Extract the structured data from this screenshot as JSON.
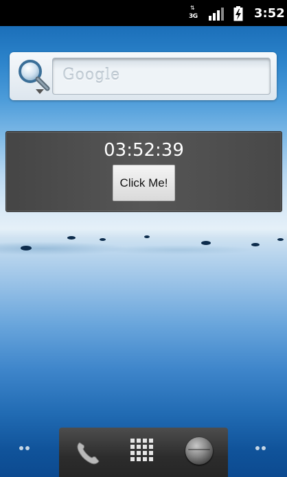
{
  "status_bar": {
    "network_type": "3G",
    "time": "3:52"
  },
  "search_widget": {
    "placeholder": "Google"
  },
  "clock_widget": {
    "time": "03:52:39",
    "button_label": "Click Me!"
  },
  "dock": {
    "items": [
      "phone-icon",
      "all-apps-icon",
      "browser-icon"
    ]
  },
  "colors": {
    "status_bar_bg": "#000000",
    "widget_bg": "#4f4f4f",
    "dock_bg": "#333333"
  }
}
